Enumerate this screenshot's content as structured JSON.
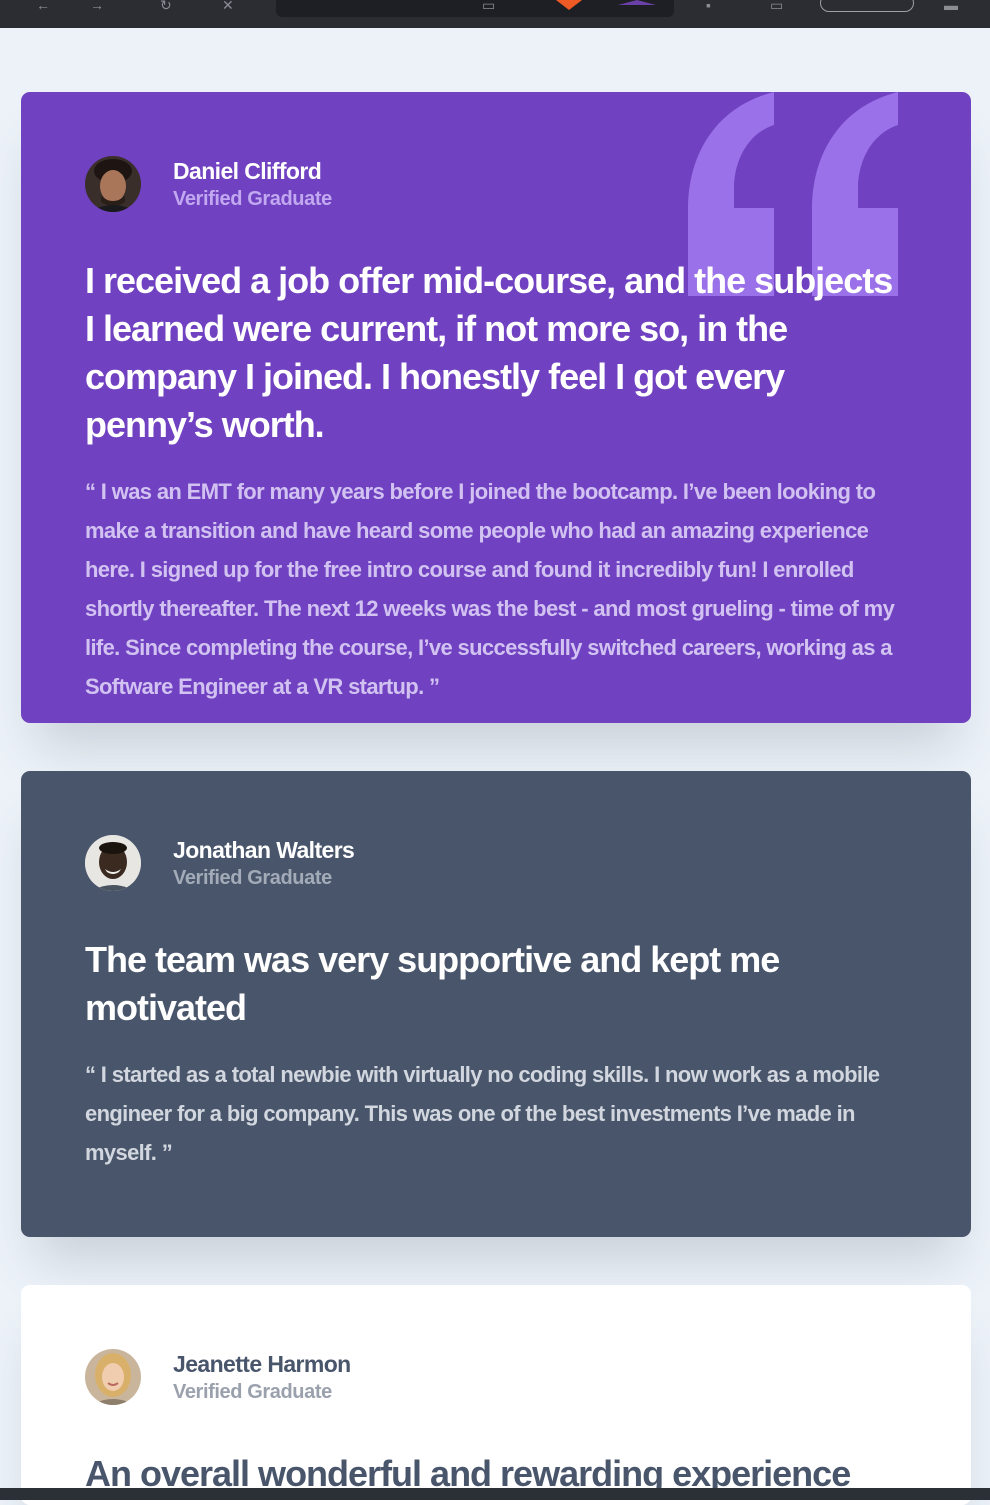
{
  "colors": {
    "page_background": "#ECF2F8",
    "daniel_card": "#7041C0",
    "daniel_quote_mark": "#9B71EA",
    "jonathan_card": "#48556A",
    "jeanette_card": "#FFFFFF"
  },
  "testimonials": [
    {
      "name": "Daniel Clifford",
      "role": "Verified Graduate",
      "headline": "I received a job offer mid-course, and the subjects I learned were current, if not more so, in the company I joined. I honestly feel I got every penny’s worth.",
      "body": "“ I was an EMT for many years before I joined the bootcamp. I’ve been looking to make a transition and have heard some people who had an amazing experience here. I signed up for the free intro course and found it incredibly fun! I enrolled shortly thereafter. The next 12 weeks was the best - and most grueling - time of my life. Since completing the course, I’ve successfully switched careers, working as a Software Engineer at a VR startup. ”"
    },
    {
      "name": "Jonathan Walters",
      "role": "Verified Graduate",
      "headline": "The team was very supportive and kept me motivated",
      "body": "“ I started as a total newbie with virtually no coding skills. I now work as a mobile engineer for a big company. This was one of the best investments I’ve made in myself. ”"
    },
    {
      "name": "Jeanette Harmon",
      "role": "Verified Graduate",
      "headline": "An overall wonderful and rewarding experience"
    }
  ]
}
